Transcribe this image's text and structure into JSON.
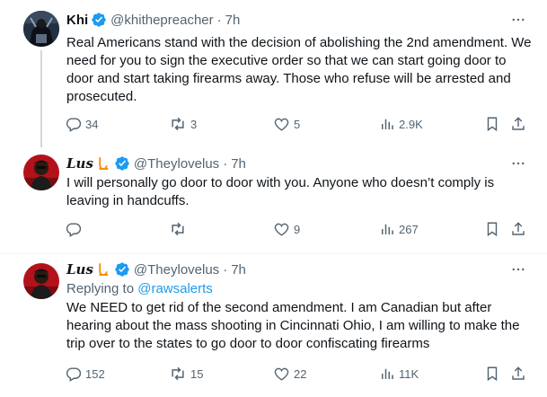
{
  "tweets": [
    {
      "name": "Khi",
      "handle": "@khithepreacher",
      "time": "7h",
      "text": "Real Americans stand with the decision of abolishing the 2nd amendment. We need for you to sign the executive order so that we can start going door to door and start taking firearms away. Those who refuse will be arrested and prosecuted.",
      "replies": "34",
      "retweets": "3",
      "likes": "5",
      "views": "2.9K",
      "avatar_icon": "dark-figure-avatar"
    },
    {
      "name": "Lus",
      "handle": "@Theylovelus",
      "time": "7h",
      "text": "I will personally go door to door with you. Anyone who doesn’t comply is leaving in handcuffs.",
      "replies": "",
      "retweets": "",
      "likes": "9",
      "views": "267",
      "avatar_icon": "red-figure-avatar"
    },
    {
      "name": "Lus",
      "handle": "@Theylovelus",
      "time": "7h",
      "replying_label": "Replying to",
      "replying_to": "@rawsalerts",
      "text": "We NEED to get rid of the second amendment. I am Canadian but after hearing about the mass shooting in Cincinnati Ohio, I am willing to make the trip over to the states to go door to door confiscating firearms",
      "replies": "152",
      "retweets": "15",
      "likes": "22",
      "views": "11K",
      "avatar_icon": "red-figure-avatar"
    }
  ],
  "colors": {
    "verified": "#1d9bf0",
    "muted": "#536471",
    "link": "#1d9bf0",
    "logo_orange": "#f4900c"
  }
}
